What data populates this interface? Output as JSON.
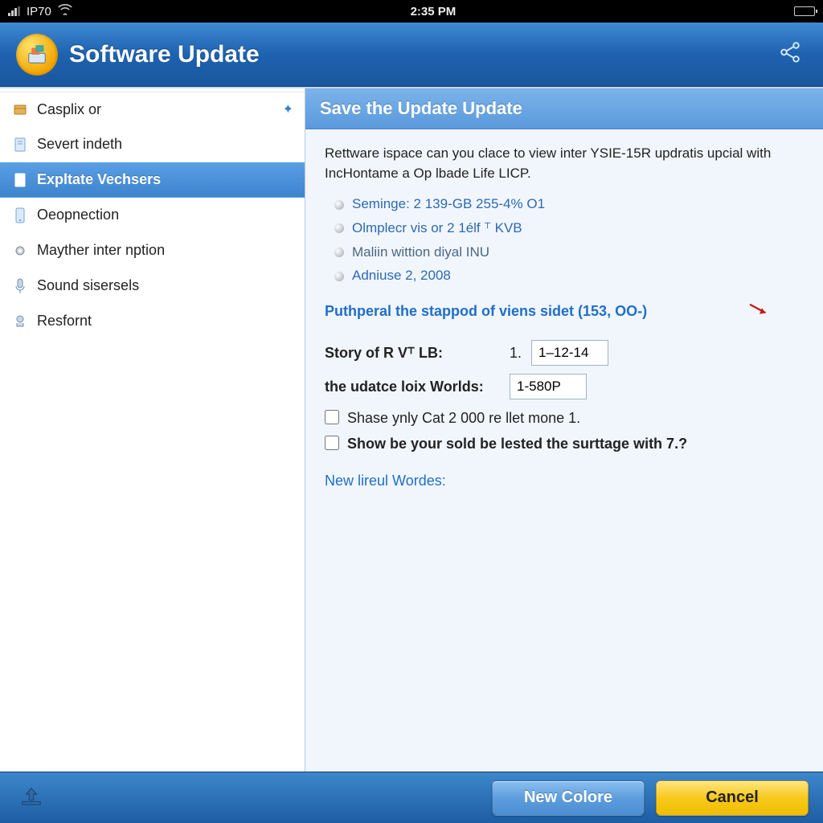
{
  "status": {
    "carrier": "IP70",
    "time": "2:35 PM"
  },
  "header": {
    "title": "Software Update"
  },
  "sidebar": {
    "items": [
      {
        "label": "Casplix or",
        "icon": "box"
      },
      {
        "label": "Severt indeth",
        "icon": "doc"
      },
      {
        "label": "Expltate Vechsers",
        "icon": "page"
      },
      {
        "label": "Oeopnection",
        "icon": "device"
      },
      {
        "label": "Mayther inter nption",
        "icon": "gear"
      },
      {
        "label": "Sound sisersels",
        "icon": "mic"
      },
      {
        "label": "Resfornt",
        "icon": "cam"
      }
    ]
  },
  "content": {
    "title": "Save the Update Update",
    "intro": "Rettware ispace can you clace to view inter YSIE-15R updratis upcial with IncHontame a Op lbade Life LICP.",
    "sublist": [
      "Seminge: 2 139-GB 255-4% O1",
      "Olmplecr vis or 2 1élf ⸆ KVB",
      "Maliin wittion diyal INU",
      "Adniuse 2, 2008"
    ],
    "putline": "Puthperal the stappod of viens sidet (153, OO-)",
    "field1_label": "Story of R V⸆ LB:",
    "field1_static": "1.",
    "field1_value": "1–12-14",
    "field2_label": "the udatce loix Worlds:",
    "field2_value": "1-580P",
    "check1": "Shase ynly Cat 2 000 re llet mone 1.",
    "check2": "Show be your sold be lested the surttage with 7.?",
    "link2": "New lireul Wordes:"
  },
  "footer": {
    "primary": "New Colore",
    "cancel": "Cancel"
  }
}
